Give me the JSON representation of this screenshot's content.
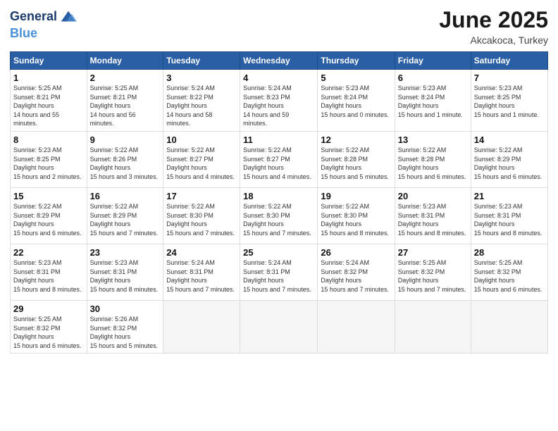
{
  "logo": {
    "line1": "General",
    "line2": "Blue"
  },
  "title": "June 2025",
  "location": "Akcakoca, Turkey",
  "weekdays": [
    "Sunday",
    "Monday",
    "Tuesday",
    "Wednesday",
    "Thursday",
    "Friday",
    "Saturday"
  ],
  "weeks": [
    [
      {
        "day": "1",
        "sunrise": "5:25 AM",
        "sunset": "8:21 PM",
        "daylight": "14 hours and 55 minutes."
      },
      {
        "day": "2",
        "sunrise": "5:25 AM",
        "sunset": "8:21 PM",
        "daylight": "14 hours and 56 minutes."
      },
      {
        "day": "3",
        "sunrise": "5:24 AM",
        "sunset": "8:22 PM",
        "daylight": "14 hours and 58 minutes."
      },
      {
        "day": "4",
        "sunrise": "5:24 AM",
        "sunset": "8:23 PM",
        "daylight": "14 hours and 59 minutes."
      },
      {
        "day": "5",
        "sunrise": "5:23 AM",
        "sunset": "8:24 PM",
        "daylight": "15 hours and 0 minutes."
      },
      {
        "day": "6",
        "sunrise": "5:23 AM",
        "sunset": "8:24 PM",
        "daylight": "15 hours and 1 minute."
      },
      {
        "day": "7",
        "sunrise": "5:23 AM",
        "sunset": "8:25 PM",
        "daylight": "15 hours and 1 minute."
      }
    ],
    [
      {
        "day": "8",
        "sunrise": "5:23 AM",
        "sunset": "8:25 PM",
        "daylight": "15 hours and 2 minutes."
      },
      {
        "day": "9",
        "sunrise": "5:22 AM",
        "sunset": "8:26 PM",
        "daylight": "15 hours and 3 minutes."
      },
      {
        "day": "10",
        "sunrise": "5:22 AM",
        "sunset": "8:27 PM",
        "daylight": "15 hours and 4 minutes."
      },
      {
        "day": "11",
        "sunrise": "5:22 AM",
        "sunset": "8:27 PM",
        "daylight": "15 hours and 4 minutes."
      },
      {
        "day": "12",
        "sunrise": "5:22 AM",
        "sunset": "8:28 PM",
        "daylight": "15 hours and 5 minutes."
      },
      {
        "day": "13",
        "sunrise": "5:22 AM",
        "sunset": "8:28 PM",
        "daylight": "15 hours and 6 minutes."
      },
      {
        "day": "14",
        "sunrise": "5:22 AM",
        "sunset": "8:29 PM",
        "daylight": "15 hours and 6 minutes."
      }
    ],
    [
      {
        "day": "15",
        "sunrise": "5:22 AM",
        "sunset": "8:29 PM",
        "daylight": "15 hours and 6 minutes."
      },
      {
        "day": "16",
        "sunrise": "5:22 AM",
        "sunset": "8:29 PM",
        "daylight": "15 hours and 7 minutes."
      },
      {
        "day": "17",
        "sunrise": "5:22 AM",
        "sunset": "8:30 PM",
        "daylight": "15 hours and 7 minutes."
      },
      {
        "day": "18",
        "sunrise": "5:22 AM",
        "sunset": "8:30 PM",
        "daylight": "15 hours and 7 minutes."
      },
      {
        "day": "19",
        "sunrise": "5:22 AM",
        "sunset": "8:30 PM",
        "daylight": "15 hours and 8 minutes."
      },
      {
        "day": "20",
        "sunrise": "5:23 AM",
        "sunset": "8:31 PM",
        "daylight": "15 hours and 8 minutes."
      },
      {
        "day": "21",
        "sunrise": "5:23 AM",
        "sunset": "8:31 PM",
        "daylight": "15 hours and 8 minutes."
      }
    ],
    [
      {
        "day": "22",
        "sunrise": "5:23 AM",
        "sunset": "8:31 PM",
        "daylight": "15 hours and 8 minutes."
      },
      {
        "day": "23",
        "sunrise": "5:23 AM",
        "sunset": "8:31 PM",
        "daylight": "15 hours and 8 minutes."
      },
      {
        "day": "24",
        "sunrise": "5:24 AM",
        "sunset": "8:31 PM",
        "daylight": "15 hours and 7 minutes."
      },
      {
        "day": "25",
        "sunrise": "5:24 AM",
        "sunset": "8:31 PM",
        "daylight": "15 hours and 7 minutes."
      },
      {
        "day": "26",
        "sunrise": "5:24 AM",
        "sunset": "8:32 PM",
        "daylight": "15 hours and 7 minutes."
      },
      {
        "day": "27",
        "sunrise": "5:25 AM",
        "sunset": "8:32 PM",
        "daylight": "15 hours and 7 minutes."
      },
      {
        "day": "28",
        "sunrise": "5:25 AM",
        "sunset": "8:32 PM",
        "daylight": "15 hours and 6 minutes."
      }
    ],
    [
      {
        "day": "29",
        "sunrise": "5:25 AM",
        "sunset": "8:32 PM",
        "daylight": "15 hours and 6 minutes."
      },
      {
        "day": "30",
        "sunrise": "5:26 AM",
        "sunset": "8:32 PM",
        "daylight": "15 hours and 5 minutes."
      },
      null,
      null,
      null,
      null,
      null
    ]
  ]
}
